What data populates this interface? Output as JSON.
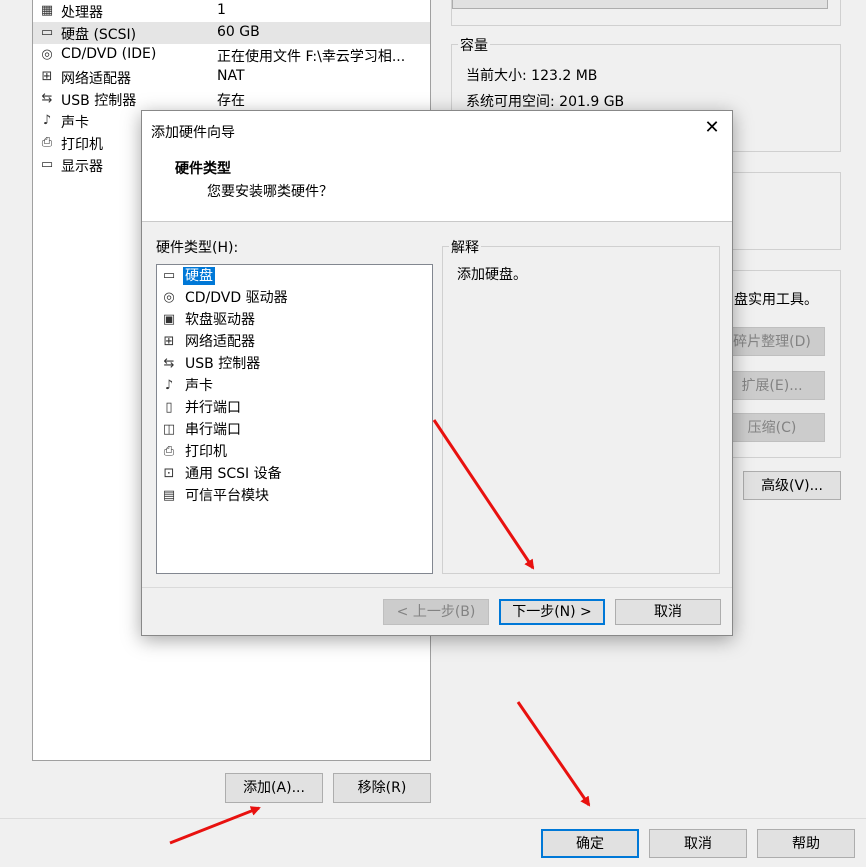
{
  "devices": [
    {
      "icon": "cpu-icon",
      "glyph": "▦",
      "name": "处理器",
      "summary": "1"
    },
    {
      "icon": "hard-disk-icon",
      "glyph": "▭",
      "name": "硬盘 (SCSI)",
      "summary": "60 GB",
      "selected": true
    },
    {
      "icon": "cd-dvd-icon",
      "glyph": "◎",
      "name": "CD/DVD (IDE)",
      "summary": "正在使用文件 F:\\幸云学习相..."
    },
    {
      "icon": "network-adapter-icon",
      "glyph": "⊞",
      "name": "网络适配器",
      "summary": "NAT"
    },
    {
      "icon": "usb-icon",
      "glyph": "⇆",
      "name": "USB 控制器",
      "summary": "存在"
    },
    {
      "icon": "sound-card-icon",
      "glyph": "♪",
      "name": "声卡",
      "summary": ""
    },
    {
      "icon": "printer-icon",
      "glyph": "⎙",
      "name": "打印机",
      "summary": ""
    },
    {
      "icon": "display-icon",
      "glyph": "▭",
      "name": "显示器",
      "summary": ""
    }
  ],
  "left_buttons": {
    "add": "添加(A)...",
    "remove": "移除(R)"
  },
  "capacity": {
    "title": "容量",
    "current_size": "当前大小: 123.2 MB",
    "available": "系统可用空间: 201.9 GB"
  },
  "disk_tools": {
    "text": "盘实用工具。",
    "defrag": "碎片整理(D)",
    "expand": "扩展(E)...",
    "compact": "压缩(C)",
    "advanced": "高级(V)..."
  },
  "bottom_buttons": {
    "ok": "确定",
    "cancel": "取消",
    "help": "帮助"
  },
  "dialog": {
    "title": "添加硬件向导",
    "heading": "硬件类型",
    "subheading": "您要安装哪类硬件？",
    "list_label": "硬件类型(H):",
    "explain_title": "解释",
    "explain_text": "添加硬盘。",
    "hardware_types": [
      {
        "icon": "hard-disk-icon",
        "glyph": "▭",
        "label": "硬盘",
        "selected": true
      },
      {
        "icon": "cd-dvd-icon",
        "glyph": "◎",
        "label": "CD/DVD 驱动器"
      },
      {
        "icon": "floppy-icon",
        "glyph": "▣",
        "label": "软盘驱动器"
      },
      {
        "icon": "network-adapter-icon",
        "glyph": "⊞",
        "label": "网络适配器"
      },
      {
        "icon": "usb-icon",
        "glyph": "⇆",
        "label": "USB 控制器"
      },
      {
        "icon": "sound-card-icon",
        "glyph": "♪",
        "label": "声卡"
      },
      {
        "icon": "parallel-port-icon",
        "glyph": "▯",
        "label": "并行端口"
      },
      {
        "icon": "serial-port-icon",
        "glyph": "◫",
        "label": "串行端口"
      },
      {
        "icon": "printer-icon",
        "glyph": "⎙",
        "label": "打印机"
      },
      {
        "icon": "scsi-device-icon",
        "glyph": "⊡",
        "label": "通用 SCSI 设备"
      },
      {
        "icon": "tpm-icon",
        "glyph": "▤",
        "label": "可信平台模块"
      }
    ],
    "buttons": {
      "back": "< 上一步(B)",
      "next": "下一步(N) >",
      "cancel": "取消"
    }
  },
  "colors": {
    "accent": "#0078d7",
    "arrow": "#e8110f"
  }
}
